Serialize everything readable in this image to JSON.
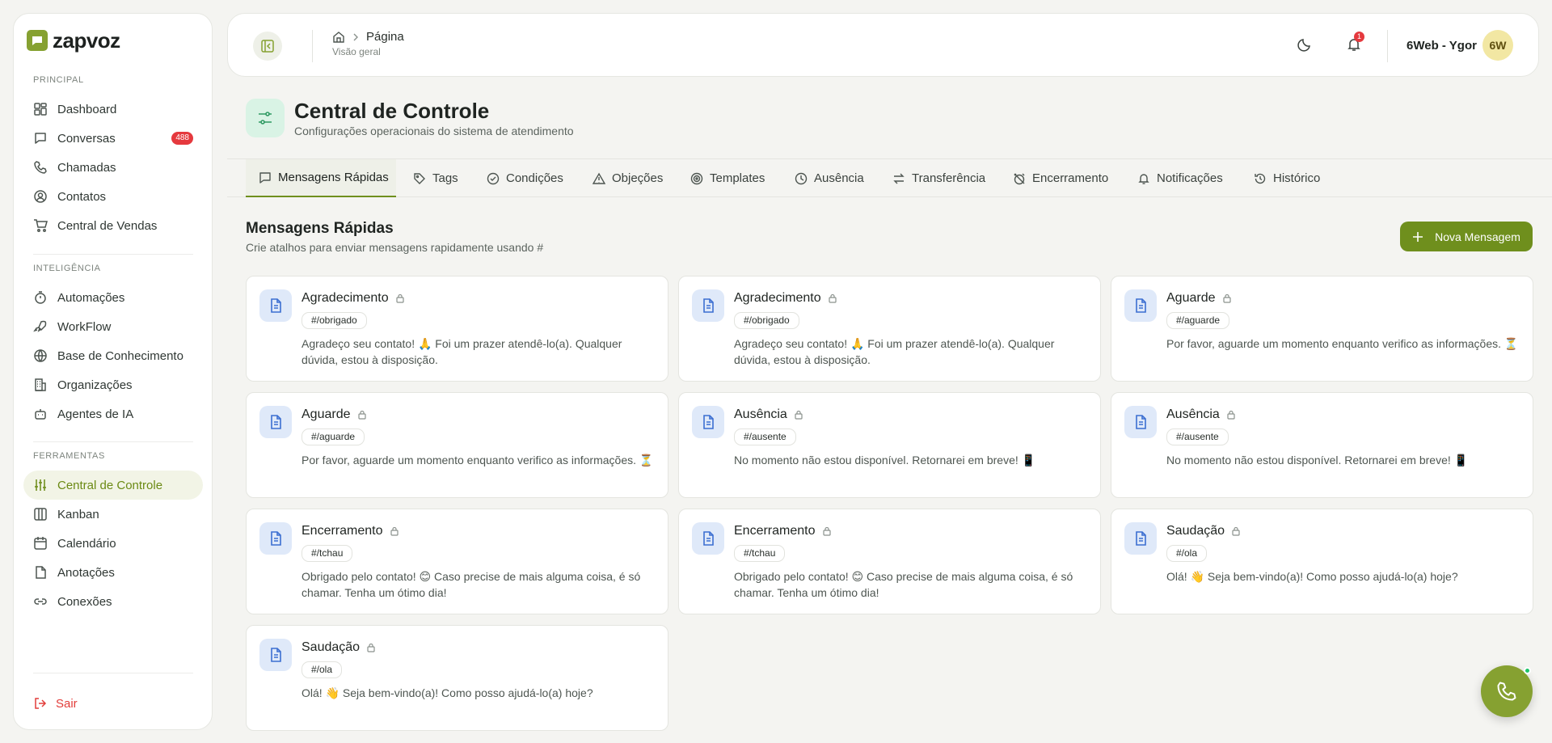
{
  "brand": {
    "name": "zapvoz"
  },
  "sidebar": {
    "sections": [
      {
        "label": "PRINCIPAL",
        "items": [
          {
            "label": "Dashboard",
            "icon": "dashboard-icon"
          },
          {
            "label": "Conversas",
            "icon": "chat-icon",
            "badge": "488"
          },
          {
            "label": "Chamadas",
            "icon": "phone-icon"
          },
          {
            "label": "Contatos",
            "icon": "contact-icon"
          },
          {
            "label": "Central de Vendas",
            "icon": "cart-icon"
          }
        ]
      },
      {
        "label": "INTELIGÊNCIA",
        "items": [
          {
            "label": "Automações",
            "icon": "timer-icon"
          },
          {
            "label": "WorkFlow",
            "icon": "rocket-icon"
          },
          {
            "label": "Base de Conhecimento",
            "icon": "globe-icon"
          },
          {
            "label": "Organizações",
            "icon": "building-icon"
          },
          {
            "label": "Agentes de IA",
            "icon": "bot-icon"
          }
        ]
      },
      {
        "label": "FERRAMENTAS",
        "items": [
          {
            "label": "Central de Controle",
            "icon": "sliders-icon",
            "active": true
          },
          {
            "label": "Kanban",
            "icon": "kanban-icon"
          },
          {
            "label": "Calendário",
            "icon": "calendar-icon"
          },
          {
            "label": "Anotações",
            "icon": "file-icon"
          },
          {
            "label": "Conexões",
            "icon": "link-icon"
          }
        ]
      }
    ],
    "logout": "Sair"
  },
  "header": {
    "breadcrumb": "Página",
    "breadcrumb_sub": "Visão geral",
    "notifications": "1",
    "user_name": "6Web - Ygor",
    "user_initials": "6W"
  },
  "page": {
    "title": "Central de Controle",
    "subtitle": "Configurações operacionais do sistema de atendimento"
  },
  "tabs": [
    {
      "label": "Mensagens Rápidas",
      "icon": "message-icon",
      "active": true
    },
    {
      "label": "Tags",
      "icon": "tag-icon"
    },
    {
      "label": "Condições",
      "icon": "check-circle-icon"
    },
    {
      "label": "Objeções",
      "icon": "warning-icon"
    },
    {
      "label": "Templates",
      "icon": "target-icon"
    },
    {
      "label": "Ausência",
      "icon": "clock-icon"
    },
    {
      "label": "Transferência",
      "icon": "swap-icon"
    },
    {
      "label": "Encerramento",
      "icon": "alarm-off-icon"
    },
    {
      "label": "Notificações",
      "icon": "bell-icon"
    },
    {
      "label": "Histórico",
      "icon": "history-icon"
    }
  ],
  "section": {
    "title": "Mensagens Rápidas",
    "subtitle": "Crie atalhos para enviar mensagens rapidamente usando #",
    "new_button": "Nova Mensagem"
  },
  "cards": [
    {
      "title": "Agradecimento",
      "tag": "#/obrigado",
      "text": "Agradeço seu contato! 🙏 Foi um prazer atendê-lo(a). Qualquer dúvida, estou à disposição."
    },
    {
      "title": "Agradecimento",
      "tag": "#/obrigado",
      "text": "Agradeço seu contato! 🙏 Foi um prazer atendê-lo(a). Qualquer dúvida, estou à disposição."
    },
    {
      "title": "Aguarde",
      "tag": "#/aguarde",
      "text": "Por favor, aguarde um momento enquanto verifico as informações. ⏳"
    },
    {
      "title": "Aguarde",
      "tag": "#/aguarde",
      "text": "Por favor, aguarde um momento enquanto verifico as informações. ⏳"
    },
    {
      "title": "Ausência",
      "tag": "#/ausente",
      "text": "No momento não estou disponível. Retornarei em breve! 📱"
    },
    {
      "title": "Ausência",
      "tag": "#/ausente",
      "text": "No momento não estou disponível. Retornarei em breve! 📱"
    },
    {
      "title": "Encerramento",
      "tag": "#/tchau",
      "text": "Obrigado pelo contato! 😊 Caso precise de mais alguma coisa, é só chamar. Tenha um ótimo dia!"
    },
    {
      "title": "Encerramento",
      "tag": "#/tchau",
      "text": "Obrigado pelo contato! 😊 Caso precise de mais alguma coisa, é só chamar. Tenha um ótimo dia!"
    },
    {
      "title": "Saudação",
      "tag": "#/ola",
      "text": "Olá! 👋 Seja bem-vindo(a)! Como posso ajudá-lo(a) hoje?"
    },
    {
      "title": "Saudação",
      "tag": "#/ola",
      "text": "Olá! 👋 Seja bem-vindo(a)! Como posso ajudá-lo(a) hoje?"
    }
  ],
  "colors": {
    "accent": "#6f8f1d",
    "brand": "#86a131",
    "danger": "#e5393e",
    "card_icon_bg": "#dfe9f9",
    "online": "#1fc46a"
  }
}
